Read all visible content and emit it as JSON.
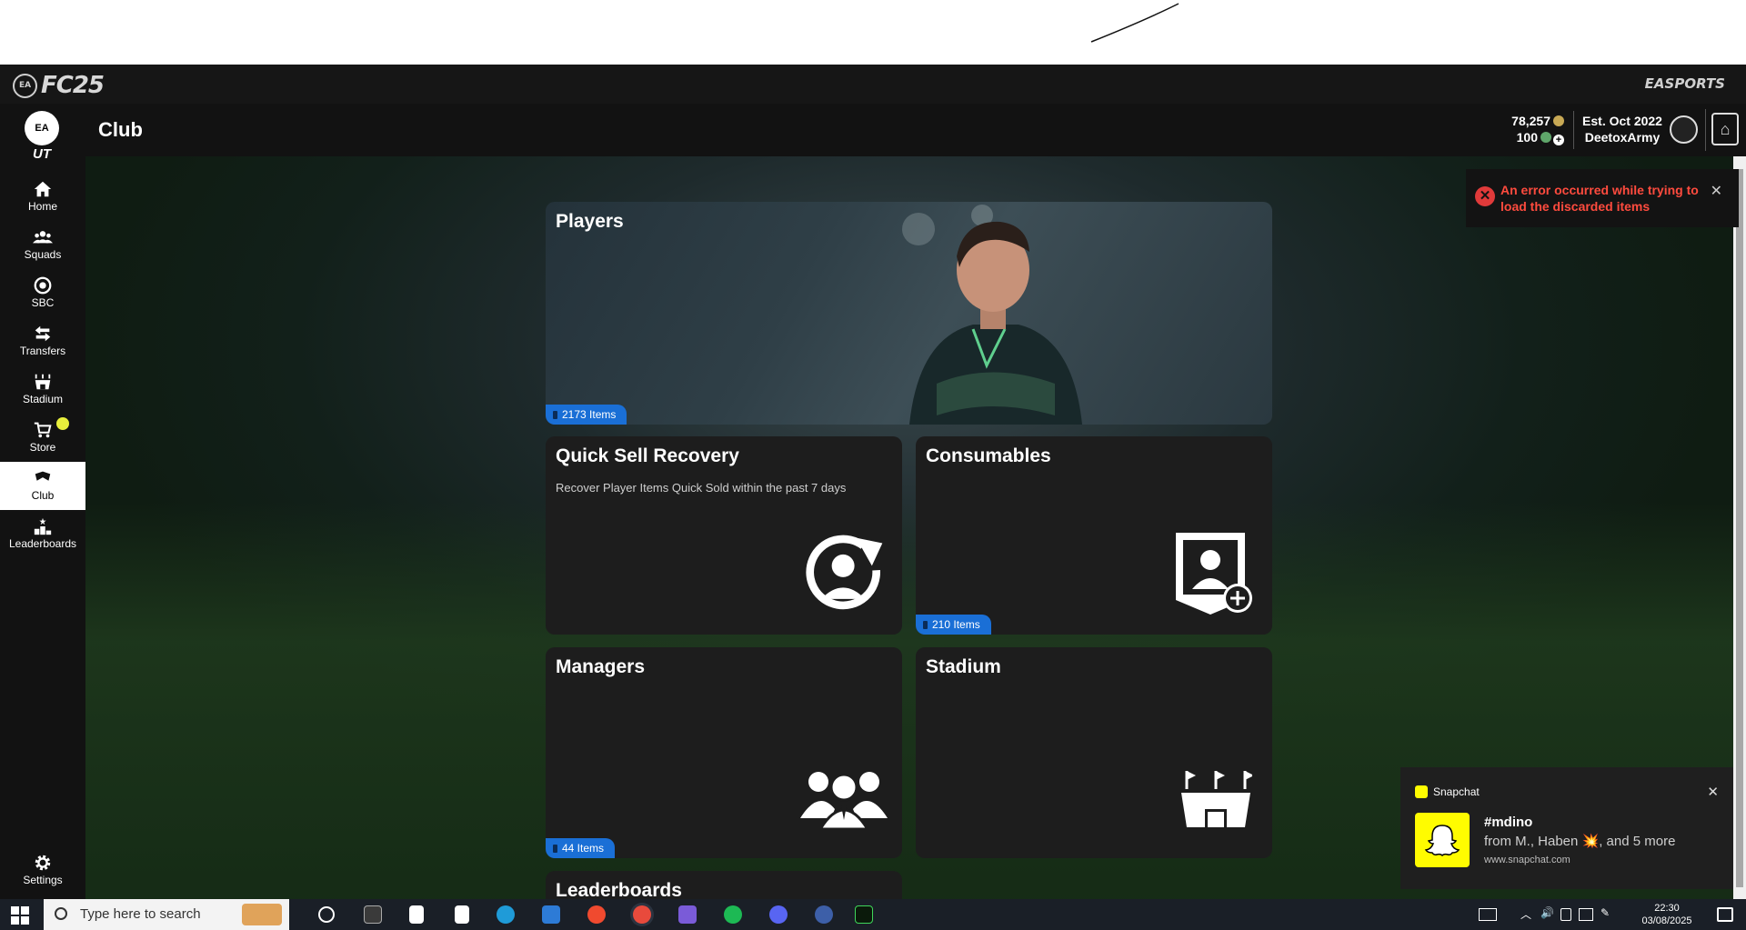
{
  "app": {
    "brand": "FC25",
    "ea_label": "EA",
    "publisher": "EASPORTS",
    "ut_label": "UT"
  },
  "header": {
    "page_title": "Club",
    "coins": "78,257",
    "points": "100",
    "est": "Est. Oct 2022",
    "club_name": "DeetoxArmy"
  },
  "sidebar": {
    "items": [
      {
        "label": "Home",
        "icon": "home-icon"
      },
      {
        "label": "Squads",
        "icon": "squads-icon"
      },
      {
        "label": "SBC",
        "icon": "sbc-icon"
      },
      {
        "label": "Transfers",
        "icon": "transfers-icon"
      },
      {
        "label": "Stadium",
        "icon": "stadium-icon"
      },
      {
        "label": "Store",
        "icon": "store-icon"
      },
      {
        "label": "Club",
        "icon": "club-icon",
        "active": true
      },
      {
        "label": "Leaderboards",
        "icon": "leaderboards-icon"
      }
    ],
    "settings_label": "Settings"
  },
  "tiles": {
    "players": {
      "title": "Players",
      "badge": "2173 Items"
    },
    "quick_sell": {
      "title": "Quick Sell Recovery",
      "desc": "Recover Player Items Quick Sold within the past 7 days"
    },
    "consumables": {
      "title": "Consumables",
      "badge": "210 Items"
    },
    "managers": {
      "title": "Managers",
      "badge": "44 Items"
    },
    "stadium": {
      "title": "Stadium"
    },
    "leaderboards": {
      "title": "Leaderboards"
    }
  },
  "error_toast": {
    "message": "An error occurred while trying to load the discarded items",
    "close": "✕"
  },
  "snapchat": {
    "app": "Snapchat",
    "title": "#mdino",
    "body": "from M., Haben 💥, and 5 more",
    "source": "www.snapchat.com",
    "close": "✕"
  },
  "taskbar": {
    "search_placeholder": "Type here to search",
    "time": "22:30",
    "date": "03/08/2025"
  },
  "colors": {
    "accent_blue": "#1a6fd6",
    "error_red": "#ff4b3e",
    "snap_yellow": "#fffc00"
  }
}
